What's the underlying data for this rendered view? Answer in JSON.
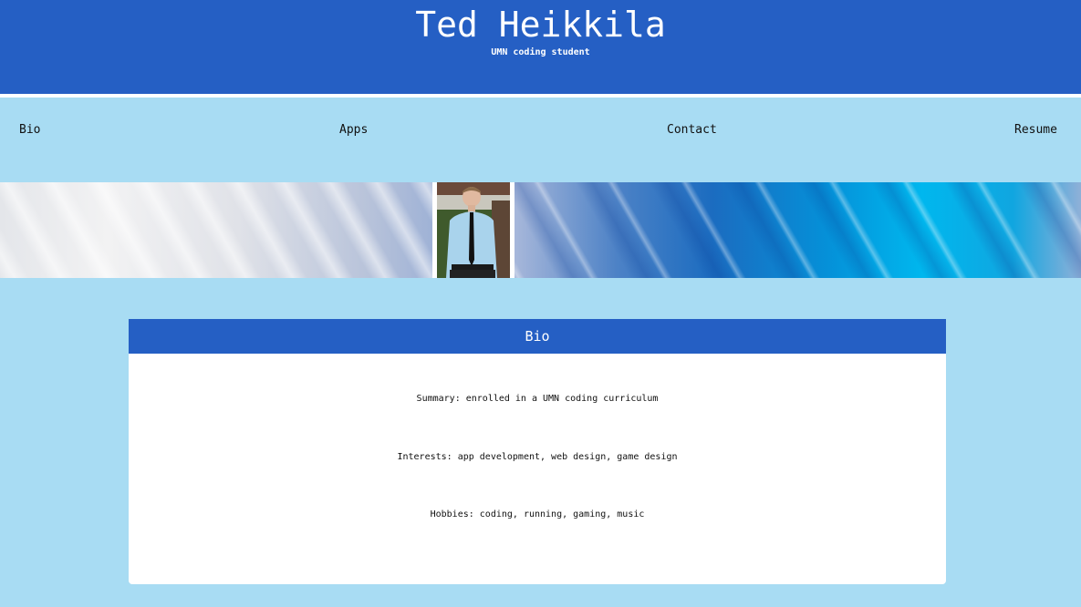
{
  "header": {
    "title": "Ted Heikkila",
    "subtitle": "UMN coding student"
  },
  "nav": {
    "items": [
      {
        "label": "Bio"
      },
      {
        "label": "Apps"
      },
      {
        "label": "Contact"
      },
      {
        "label": "Resume"
      }
    ]
  },
  "banner": {
    "photo_alt": "portrait photo"
  },
  "bio_card": {
    "title": "Bio",
    "lines": [
      "Summary: enrolled in a UMN coding curriculum",
      "Interests: app development, web design, game design",
      "Hobbies: coding, running, gaming, music"
    ]
  },
  "colors": {
    "header_bg": "#255fc4",
    "page_bg": "#a8dcf3",
    "card_bg": "#ffffff"
  }
}
